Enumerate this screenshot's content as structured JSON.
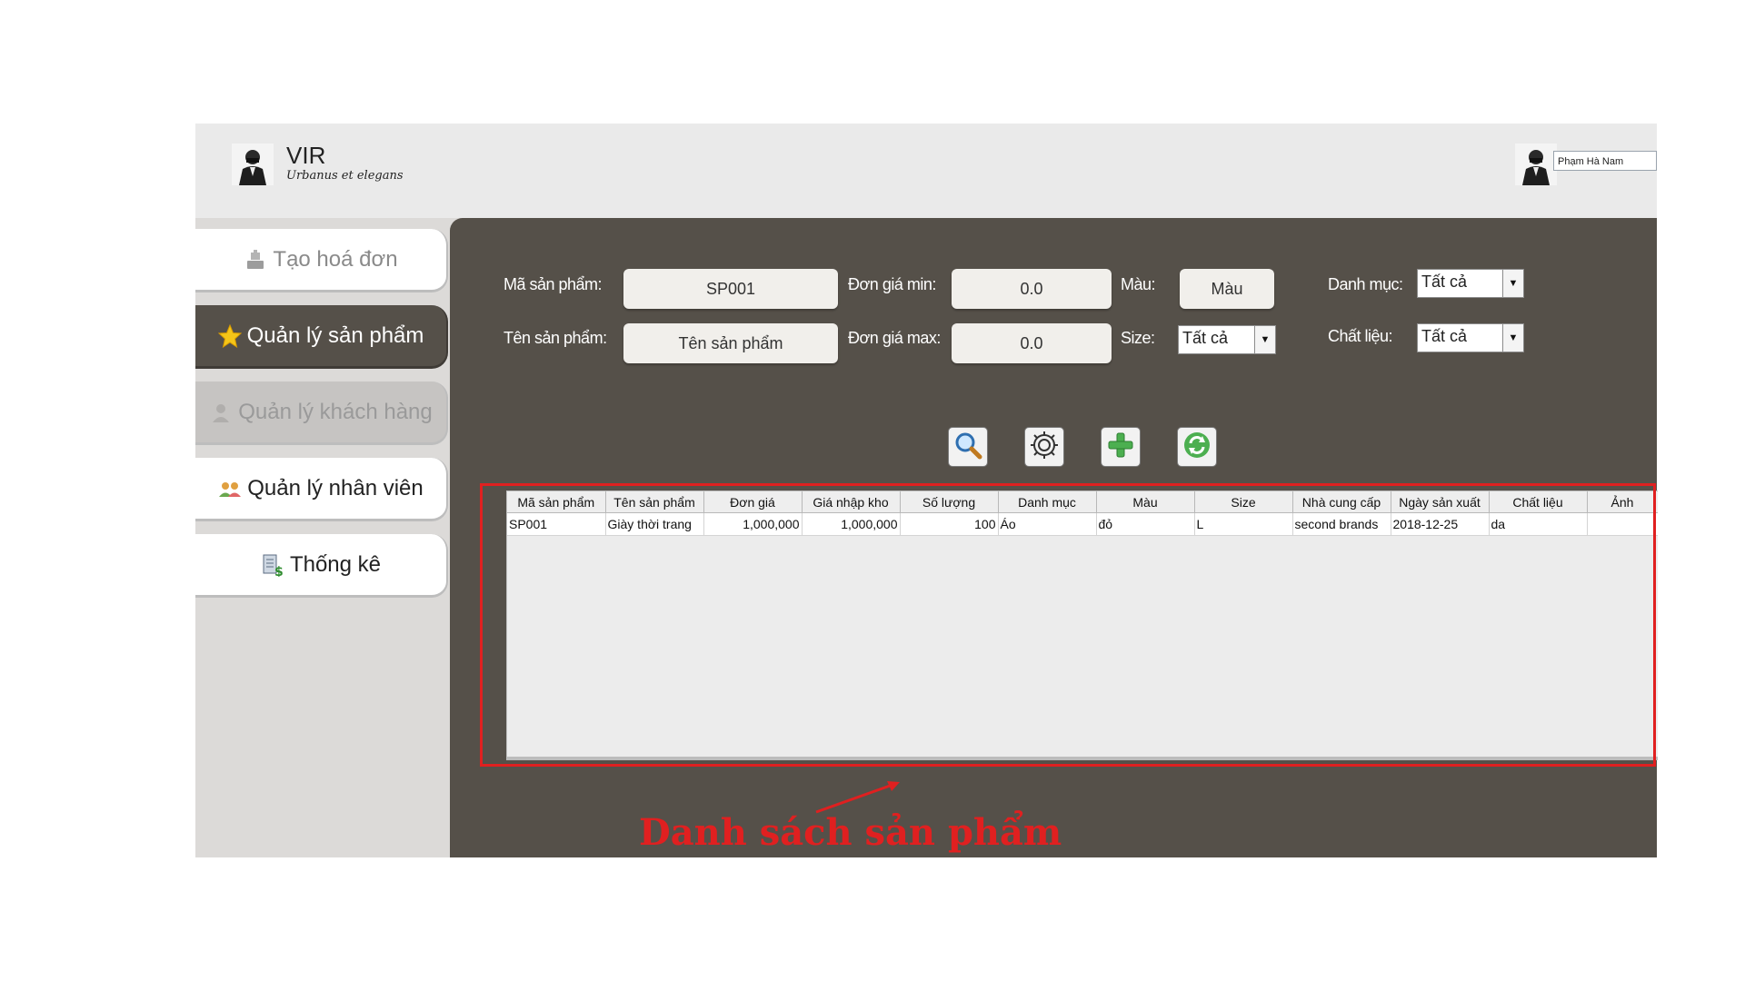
{
  "app": {
    "brand_name": "VIR",
    "tagline": "Urbanus et elegans",
    "user_name": "Phạm Hà Nam"
  },
  "sidebar": {
    "items": [
      {
        "label": "Tạo hoá đơn",
        "icon": "cashier-icon",
        "state": "normal"
      },
      {
        "label": "Quản lý sản phẩm",
        "icon": "star-icon",
        "state": "active"
      },
      {
        "label": "Quản lý khách hàng",
        "icon": "user-icon",
        "state": "disabled"
      },
      {
        "label": "Quản lý nhân viên",
        "icon": "users-icon",
        "state": "normal"
      },
      {
        "label": "Thống kê",
        "icon": "report-icon",
        "state": "normal"
      }
    ]
  },
  "filters": {
    "ma_san_pham": {
      "label": "Mã sản phẩm:",
      "value": "SP001"
    },
    "ten_san_pham": {
      "label": "Tên sản phẩm:",
      "value": "Tên sản phẩm"
    },
    "don_gia_min": {
      "label": "Đơn giá min:",
      "value": "0.0"
    },
    "don_gia_max": {
      "label": "Đơn giá max:",
      "value": "0.0"
    },
    "mau": {
      "label": "Màu:",
      "value": "Màu"
    },
    "size": {
      "label": "Size:",
      "selected": "Tất cả"
    },
    "danh_muc": {
      "label": "Danh mục:",
      "selected": "Tất cả"
    },
    "chat_lieu": {
      "label": "Chất liệu:",
      "selected": "Tất cả"
    }
  },
  "actions": [
    "search-icon",
    "gear-icon",
    "add-icon",
    "refresh-icon"
  ],
  "table": {
    "columns": [
      "Mã sản phẩm",
      "Tên sản phẩm",
      "Đơn giá",
      "Giá nhập kho",
      "Số lượng",
      "Danh mục",
      "Màu",
      "Size",
      "Nhà cung cấp",
      "Ngày sản xuất",
      "Chất liệu",
      "Ảnh"
    ],
    "rows": [
      [
        "SP001",
        "Giày thời trang",
        "1,000,000",
        "1,000,000",
        "100",
        "Áo",
        "đỏ",
        "L",
        "second brands",
        "2018-12-25",
        "da",
        ""
      ]
    ]
  },
  "annotation": {
    "label": "Danh sách sản phẩm",
    "color": "#e02020"
  },
  "colors": {
    "panel": "#555049",
    "sidebar": "#dcdad8",
    "header": "#eaeaea"
  }
}
